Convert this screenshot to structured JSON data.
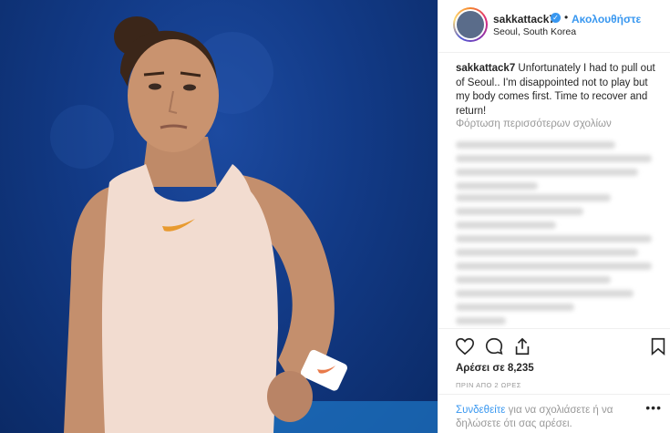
{
  "post": {
    "username": "sakkattack7",
    "verified_mark": "✓",
    "separator": "•",
    "follow_label": "Ακολουθήστε",
    "location": "Seoul, South Korea"
  },
  "caption": {
    "username": "sakkattack7",
    "text": " Unfortunately I had to pull out of Seoul.. I'm disappointed not to play but my body comes first. Time to recover and return!"
  },
  "comments": {
    "load_more": "Φόρτωση περισσότερων σχολίων"
  },
  "actions": {
    "like_icon": "heart-icon",
    "comment_icon": "comment-icon",
    "share_icon": "share-icon",
    "save_icon": "bookmark-icon"
  },
  "stats": {
    "likes": "Αρέσει σε 8,235",
    "time_ago": "ΠΡΙΝ ΑΠΟ 2 ΩΡΕΣ"
  },
  "login": {
    "link": "Συνδεθείτε",
    "text": " για να σχολιάσετε ή να δηλώσετε ότι σας αρέσει.",
    "more": "•••"
  },
  "colors": {
    "accent": "#3897f0",
    "background_blue": "#123a86"
  }
}
